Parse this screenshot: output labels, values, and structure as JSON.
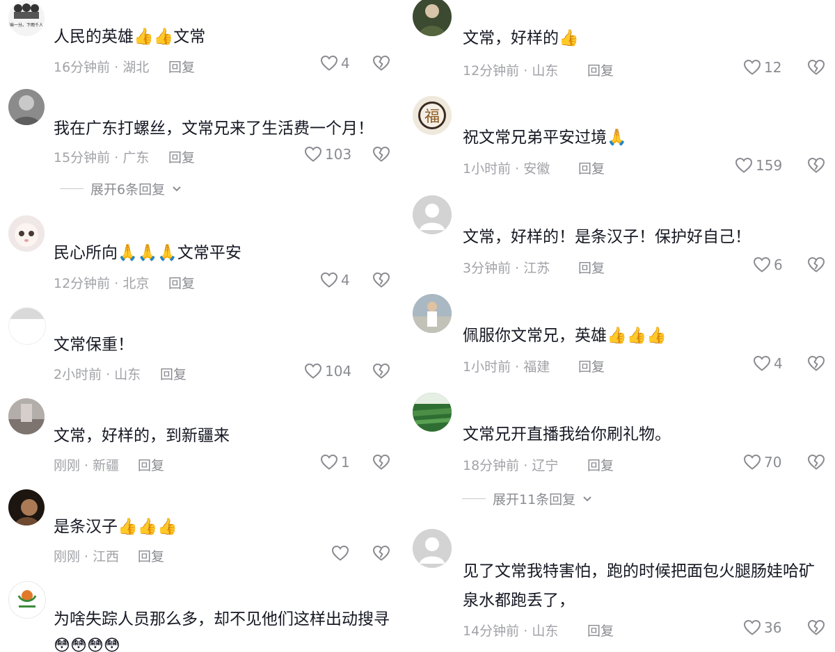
{
  "left_comments": [
    {
      "text": "人民的英雄👍👍文常",
      "time": "16分钟前",
      "location": "湖北",
      "reply": "回复",
      "likes": "4"
    },
    {
      "text": "我在广东打螺丝，文常兄来了生活费一个月！",
      "time": "15分钟前",
      "location": "广东",
      "reply": "回复",
      "likes": "103",
      "expand": "展开6条回复"
    },
    {
      "text": "民心所向🙏🙏🙏文常平安",
      "time": "12分钟前",
      "location": "北京",
      "reply": "回复",
      "likes": "4"
    },
    {
      "text": "文常保重！",
      "time": "2小时前",
      "location": "山东",
      "reply": "回复",
      "likes": "104"
    },
    {
      "text": "文常，好样的，到新疆来",
      "time": "刚刚",
      "location": "新疆",
      "reply": "回复",
      "likes": "1"
    },
    {
      "text": "是条汉子👍👍👍",
      "time": "刚刚",
      "location": "江西",
      "reply": "回复",
      "likes": ""
    },
    {
      "text": "为啥失踪人员那么多，却不见他们这样出动搜寻😳😳😳😳"
    }
  ],
  "right_comments": [
    {
      "text": "文常，好样的👍",
      "time": "12分钟前",
      "location": "山东",
      "reply": "回复",
      "likes": "12"
    },
    {
      "text": "祝文常兄弟平安过境🙏",
      "time": "1小时前",
      "location": "安徽",
      "reply": "回复",
      "likes": "159"
    },
    {
      "text": "文常，好样的！是条汉子！保护好自己！",
      "time": "3分钟前",
      "location": "江苏",
      "reply": "回复",
      "likes": "6"
    },
    {
      "text": "佩服你文常兄，英雄👍👍👍",
      "time": "1小时前",
      "location": "福建",
      "reply": "回复",
      "likes": "4"
    },
    {
      "text": "文常兄开直播我给你刷礼物。",
      "time": "18分钟前",
      "location": "辽宁",
      "reply": "回复",
      "likes": "70",
      "expand": "展开11条回复"
    },
    {
      "text": "见了文常我特害怕，跑的时候把面包火腿肠娃哈矿泉水都跑丢了，",
      "time": "14分钟前",
      "location": "山东",
      "reply": "回复",
      "likes": "36"
    }
  ],
  "avatar_texts": {
    "left_0": "要麻一分。下雨千人！",
    "right_1": "福"
  },
  "icons": {
    "like": "heart-outline-icon",
    "dislike": "broken-heart-icon",
    "expand": "chevron-down-icon"
  },
  "colors": {
    "text": "#161823",
    "meta": "#a1a2a7",
    "icon": "#8a8b91"
  }
}
